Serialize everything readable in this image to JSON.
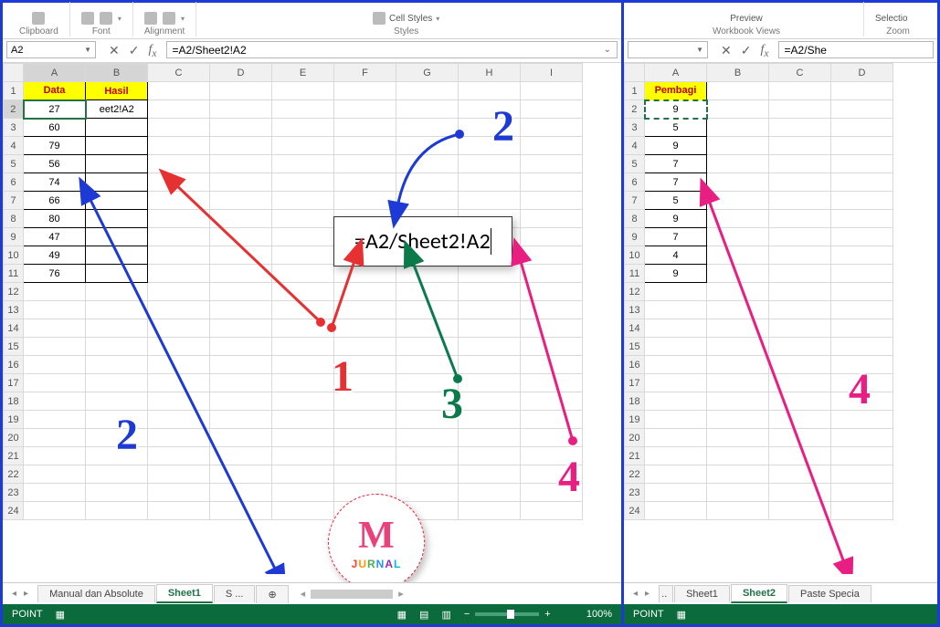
{
  "left": {
    "ribbon_groups": [
      "Clipboard",
      "Font",
      "Alignment",
      "Styles"
    ],
    "ribbon_cellstyles": "Cell Styles",
    "namebox": "A2",
    "formula": "=A2/Sheet2!A2",
    "columns": [
      "A",
      "B",
      "C",
      "D",
      "E",
      "F",
      "G",
      "H",
      "I"
    ],
    "rows": [
      1,
      2,
      3,
      4,
      5,
      6,
      7,
      8,
      9,
      10,
      11,
      12,
      13,
      14,
      15,
      16,
      17,
      18,
      19,
      20,
      21,
      22,
      23,
      24
    ],
    "header": {
      "A": "Data",
      "B": "Hasil"
    },
    "data": [
      "27",
      "60",
      "79",
      "56",
      "74",
      "66",
      "80",
      "47",
      "49",
      "76"
    ],
    "b2_display": "eet2!A2",
    "tabs": {
      "nav": [
        "◂",
        "▸"
      ],
      "t1": "Manual dan Absolute",
      "t2": "Sheet1",
      "t3": "S ..."
    },
    "status": {
      "mode": "POINT",
      "zoom": "100%"
    }
  },
  "right": {
    "ribbon_groups": [
      "Workbook Views",
      "Zoom"
    ],
    "ribbon_preview": "Preview",
    "ribbon_selection": "Selectio",
    "formula_cut": "=A2/She",
    "columns": [
      "A",
      "B",
      "C",
      "D"
    ],
    "rows": [
      1,
      2,
      3,
      4,
      5,
      6,
      7,
      8,
      9,
      10,
      11,
      12,
      13,
      14,
      15,
      16,
      17,
      18,
      19,
      20,
      21,
      22,
      23,
      24
    ],
    "header": {
      "A": "Pembagi"
    },
    "data": [
      "9",
      "5",
      "9",
      "7",
      "7",
      "5",
      "9",
      "7",
      "4",
      "9"
    ],
    "tabs": {
      "t1": "Sheet1",
      "t2": "Sheet2",
      "t3": "Paste Specia"
    },
    "status": {
      "mode": "POINT"
    }
  },
  "floating_formula": "=A2/Sheet2!A2",
  "annotations": {
    "n1": "1",
    "n2": "2",
    "n3": "3",
    "n4": "4"
  },
  "logo": {
    "m": "M",
    "jurnal": "JURNAL"
  },
  "chart_data": {
    "type": "table",
    "title": "Excel cross-sheet division example",
    "sheet1": {
      "columns": [
        "Data",
        "Hasil"
      ],
      "Data": [
        27,
        60,
        79,
        56,
        74,
        66,
        80,
        47,
        49,
        76
      ],
      "Hasil_formula_row2": "=A2/Sheet2!A2"
    },
    "sheet2": {
      "columns": [
        "Pembagi"
      ],
      "Pembagi": [
        9,
        5,
        9,
        7,
        7,
        5,
        9,
        7,
        4,
        9
      ]
    }
  }
}
